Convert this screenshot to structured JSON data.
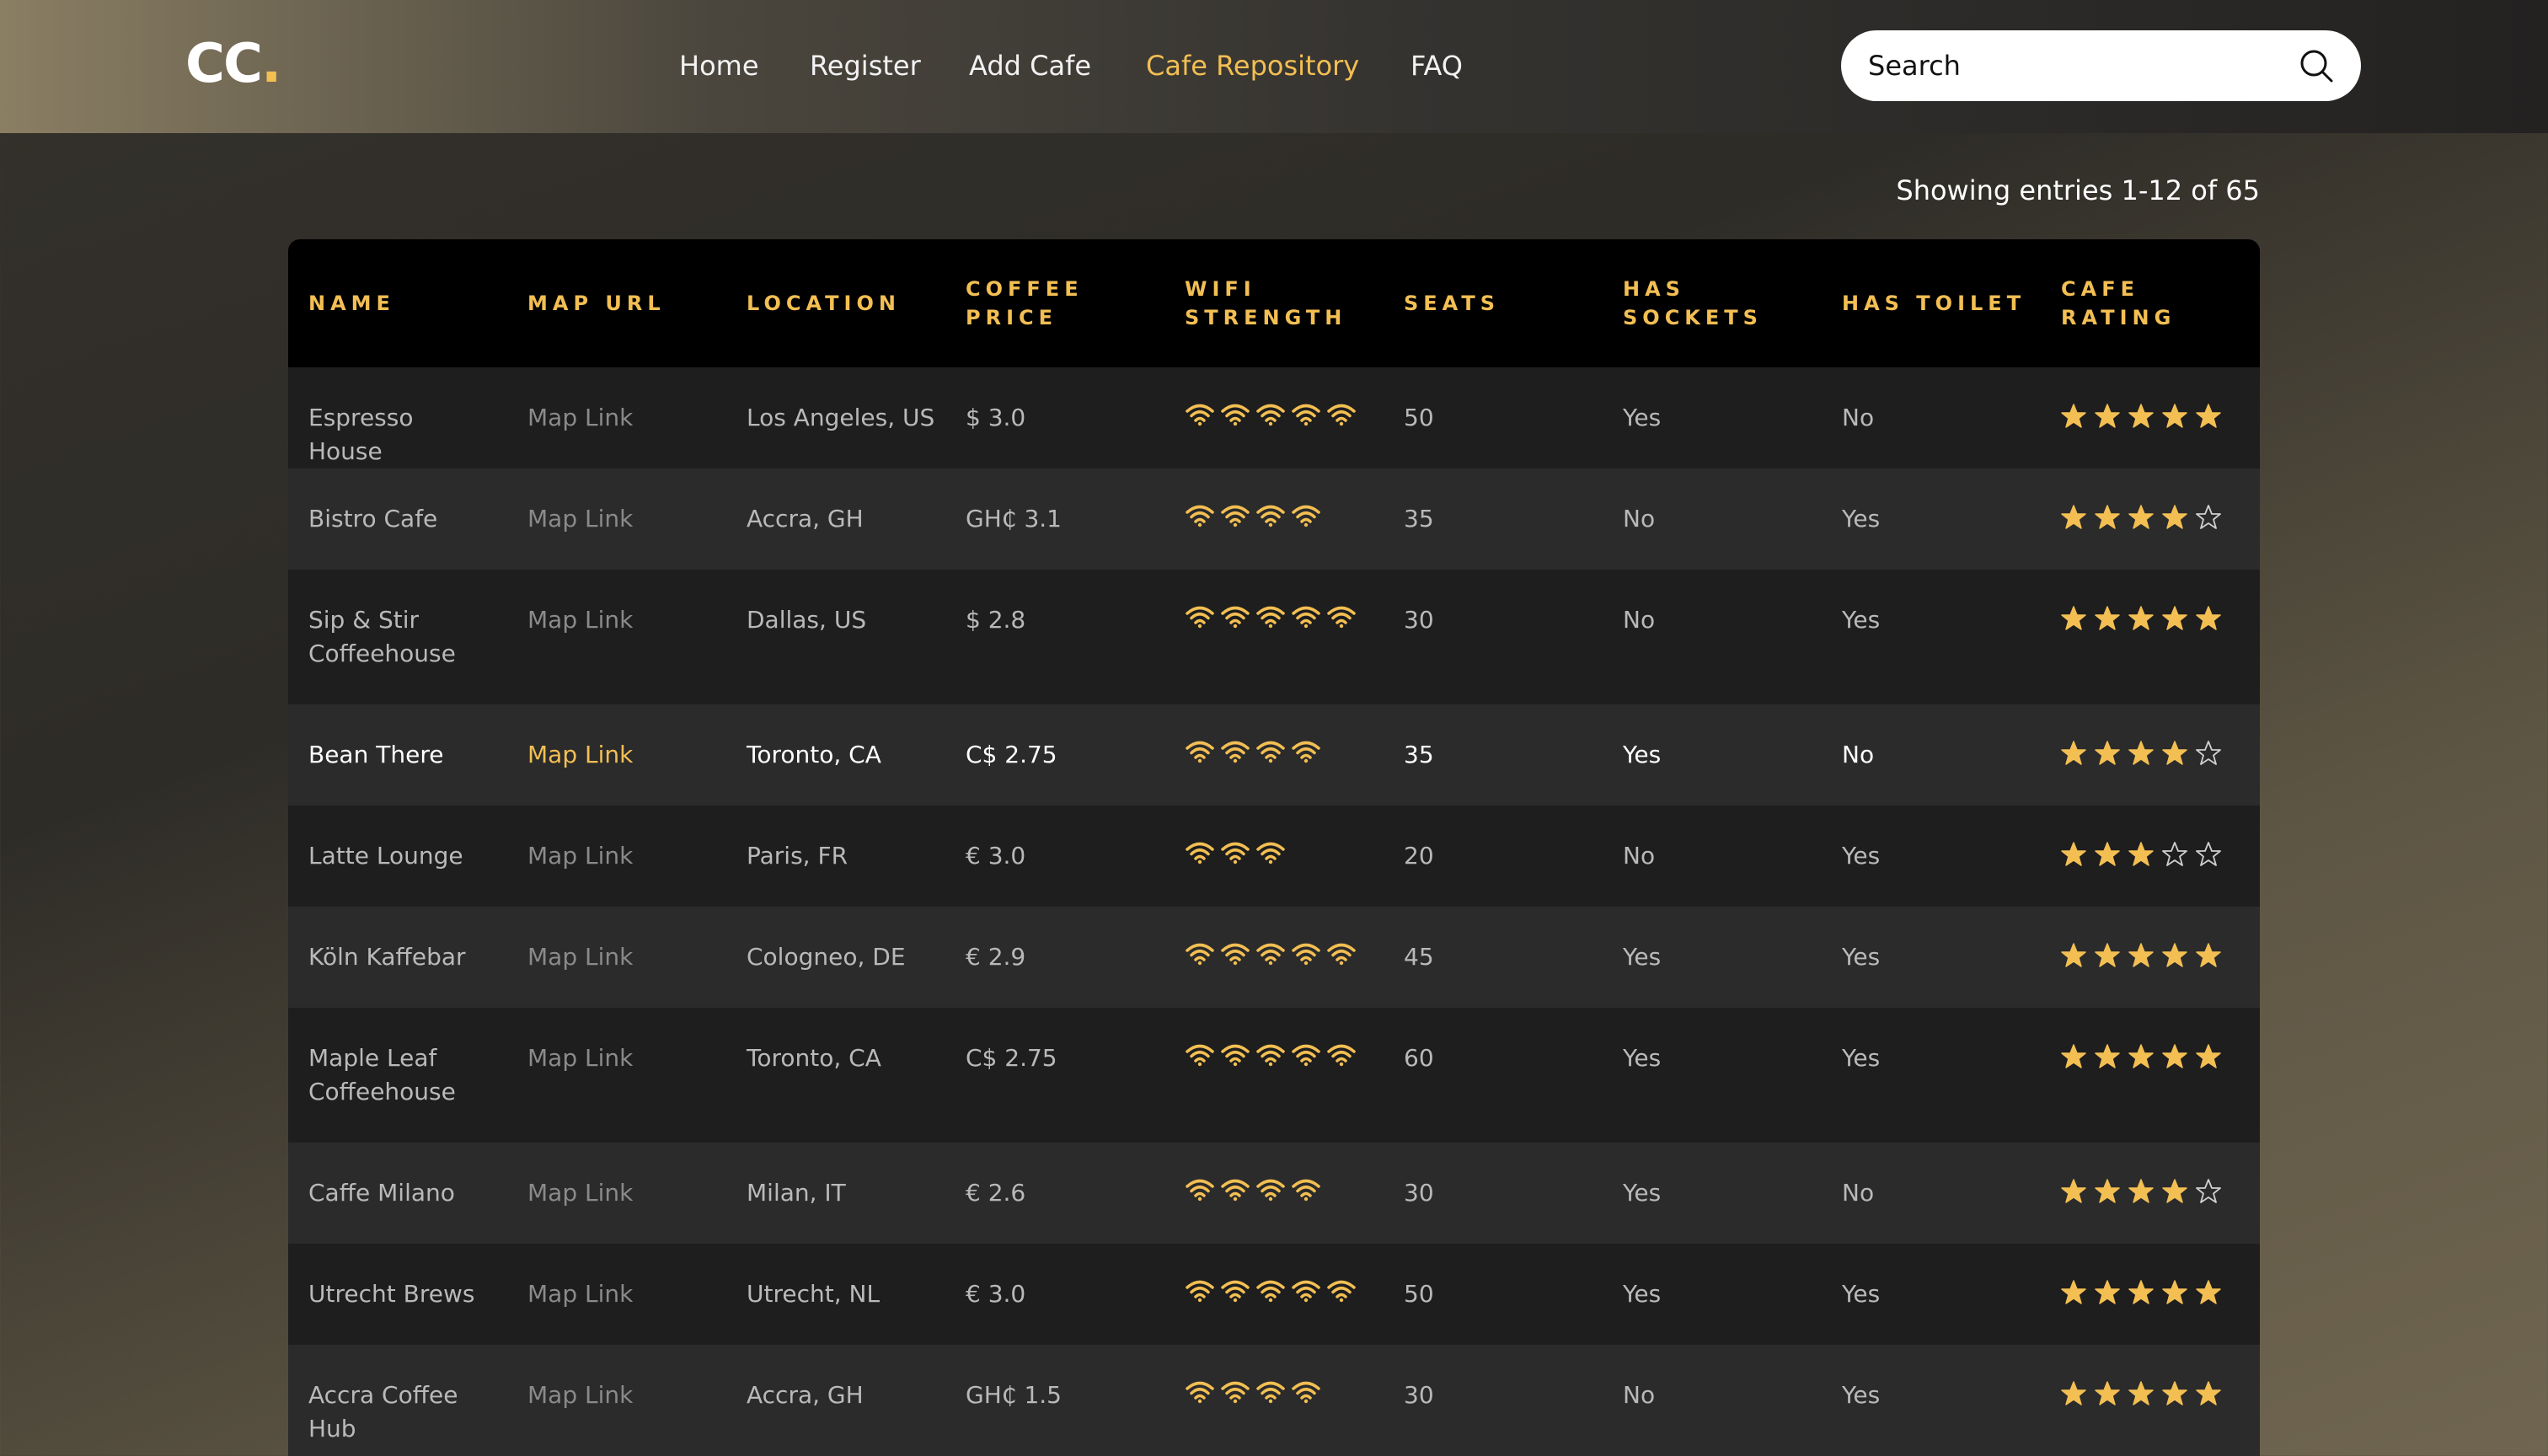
{
  "logo": {
    "text": "CC",
    "dot": "."
  },
  "nav": [
    {
      "label": "Home",
      "active": false
    },
    {
      "label": "Register",
      "active": false
    },
    {
      "label": "Add Cafe",
      "active": false
    },
    {
      "label": "Cafe Repository",
      "active": true
    },
    {
      "label": "FAQ",
      "active": false
    }
  ],
  "search": {
    "placeholder": "Search",
    "icon": "search-icon"
  },
  "showing": "Showing entries 1-12 of 65",
  "colors": {
    "accent": "#f3bf53",
    "header_row": "#000000",
    "row_dark": "#1e1e1e",
    "row_light": "#2b2b2b"
  },
  "table": {
    "headers": [
      "NAME",
      "MAP URL",
      "LOCATION",
      "COFFEE PRICE",
      "WIFI STRENGTH",
      "SEATS",
      "HAS SOCKETS",
      "HAS TOILET",
      "CAFE RATING"
    ],
    "rows": [
      {
        "name": "Espresso House",
        "map": "Map Link",
        "location": "Los Angeles, US",
        "price": "$ 3.0",
        "wifi": 5,
        "seats": "50",
        "sockets": "Yes",
        "toilet": "No",
        "rating": 5
      },
      {
        "name": "Bistro Cafe",
        "map": "Map Link",
        "location": "Accra, GH",
        "price": "GH₵ 3.1",
        "wifi": 4,
        "seats": "35",
        "sockets": "No",
        "toilet": "Yes",
        "rating": 4
      },
      {
        "name": "Sip & Stir Coffeehouse",
        "map": "Map Link",
        "location": "Dallas, US",
        "price": "$ 2.8",
        "wifi": 5,
        "seats": "30",
        "sockets": "No",
        "toilet": "Yes",
        "rating": 5
      },
      {
        "name": "Bean There",
        "map": "Map Link",
        "location": "Toronto, CA",
        "price": "C$ 2.75",
        "wifi": 4,
        "seats": "35",
        "sockets": "Yes",
        "toilet": "No",
        "rating": 4,
        "highlighted": true
      },
      {
        "name": "Latte Lounge",
        "map": "Map Link",
        "location": "Paris, FR",
        "price": "€ 3.0",
        "wifi": 3,
        "seats": "20",
        "sockets": "No",
        "toilet": "Yes",
        "rating": 3
      },
      {
        "name": "Köln Kaffebar",
        "map": "Map Link",
        "location": "Cologneo, DE",
        "price": "€ 2.9",
        "wifi": 5,
        "seats": "45",
        "sockets": "Yes",
        "toilet": "Yes",
        "rating": 5
      },
      {
        "name": "Maple Leaf Coffeehouse",
        "map": "Map Link",
        "location": "Toronto, CA",
        "price": "C$ 2.75",
        "wifi": 5,
        "seats": "60",
        "sockets": "Yes",
        "toilet": "Yes",
        "rating": 5
      },
      {
        "name": "Caffe Milano",
        "map": "Map Link",
        "location": "Milan, IT",
        "price": "€ 2.6",
        "wifi": 4,
        "seats": "30",
        "sockets": "Yes",
        "toilet": "No",
        "rating": 4
      },
      {
        "name": "Utrecht Brews",
        "map": "Map Link",
        "location": "Utrecht, NL",
        "price": "€ 3.0",
        "wifi": 5,
        "seats": "50",
        "sockets": "Yes",
        "toilet": "Yes",
        "rating": 5
      },
      {
        "name": "Accra Coffee Hub",
        "map": "Map Link",
        "location": "Accra, GH",
        "price": "GH₵ 1.5",
        "wifi": 4,
        "seats": "30",
        "sockets": "No",
        "toilet": "Yes",
        "rating": 5
      }
    ]
  }
}
